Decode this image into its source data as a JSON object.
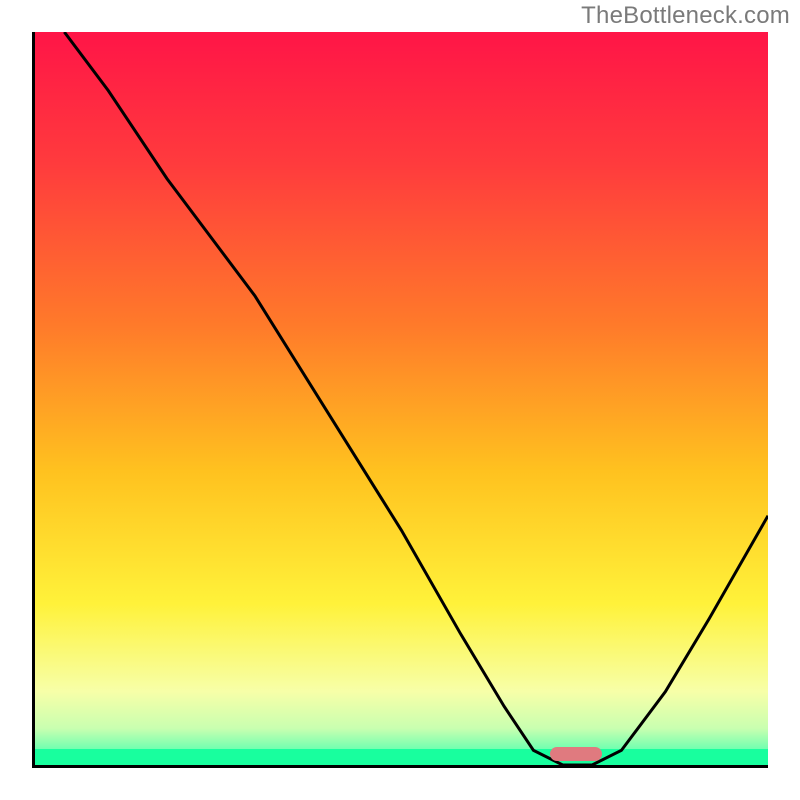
{
  "watermark": "TheBottleneck.com",
  "chart_data": {
    "type": "line",
    "title": "",
    "xlabel": "",
    "ylabel": "",
    "xlim": [
      0,
      100
    ],
    "ylim": [
      0,
      100
    ],
    "x": [
      4,
      10,
      18,
      24,
      30,
      40,
      50,
      58,
      64,
      68,
      72,
      76,
      80,
      86,
      92,
      100
    ],
    "y": [
      100,
      92,
      80,
      72,
      64,
      48,
      32,
      18,
      8,
      2,
      0,
      0,
      2,
      10,
      20,
      34
    ],
    "marker": {
      "x_start": 70,
      "x_end": 77,
      "y": 0.6
    },
    "gradient_stops": [
      {
        "pct": 0,
        "color": "#ff1547"
      },
      {
        "pct": 18,
        "color": "#ff3b3d"
      },
      {
        "pct": 40,
        "color": "#ff7a2a"
      },
      {
        "pct": 60,
        "color": "#ffc21f"
      },
      {
        "pct": 78,
        "color": "#fff23a"
      },
      {
        "pct": 90,
        "color": "#f7ffa8"
      },
      {
        "pct": 95,
        "color": "#c9ffb0"
      },
      {
        "pct": 100,
        "color": "#2dffb0"
      }
    ],
    "green_floor_pct": 2.2
  }
}
